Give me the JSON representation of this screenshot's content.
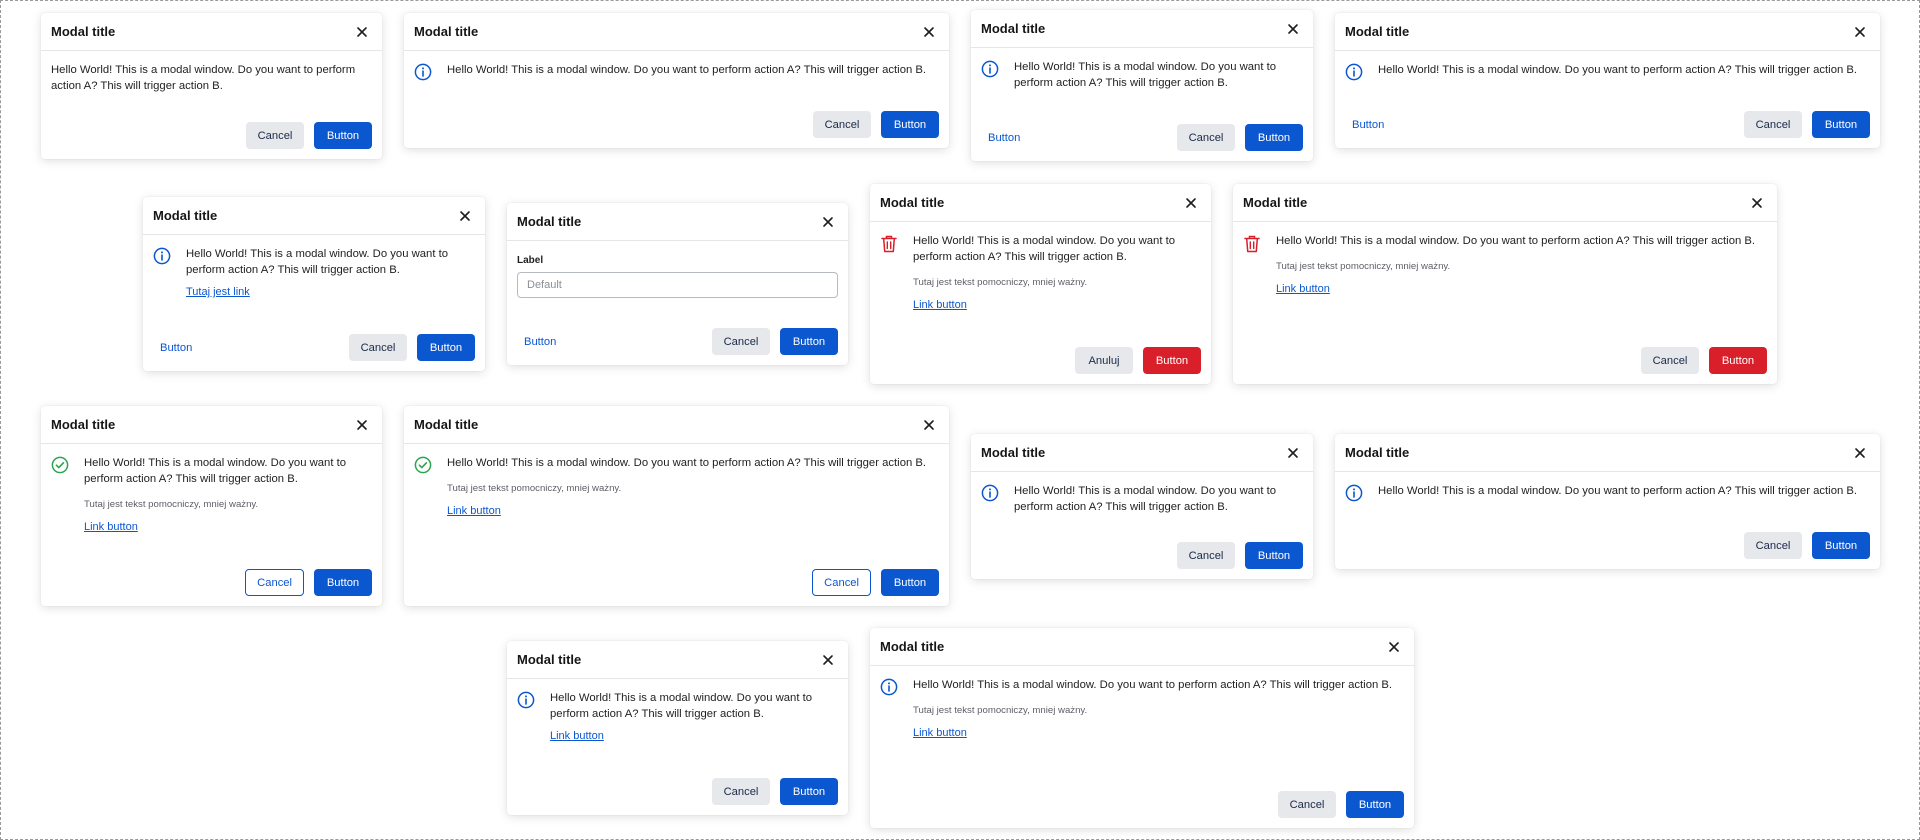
{
  "common": {
    "modal_title": "Modal title",
    "message": "Hello World! This is a modal window. Do you want to perform action A? This will trigger action B.",
    "helper": "Tutaj jest tekst pomocniczy, mniej ważny.",
    "link_button": "Link button",
    "cancel": "Cancel",
    "button": "Button",
    "text_button": "Button"
  },
  "modal_6": {
    "field_label": "Label",
    "field_placeholder": "Default"
  },
  "modal_5": {
    "link": "Tutaj jest link"
  },
  "modal_7": {
    "cancel": "Anuluj"
  },
  "icons": {
    "close": "close-icon",
    "info": "info-icon",
    "trash": "trash-icon",
    "success": "check-circle-icon"
  },
  "colors": {
    "primary": "#0b57d0",
    "danger": "#d81f2a",
    "success": "#2da44e",
    "secondary_bg": "#e6e8ec"
  }
}
